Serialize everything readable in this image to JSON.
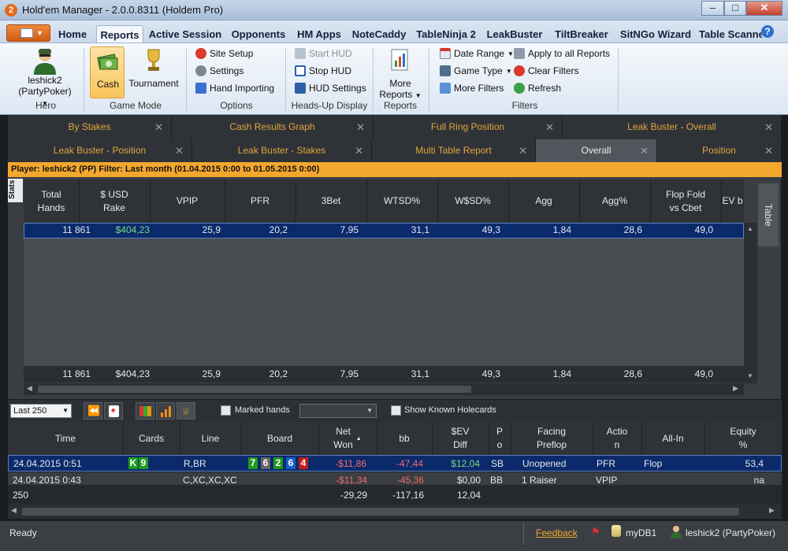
{
  "window": {
    "title": "Hold'em Manager - 2.0.0.8311 (Holdem Pro)",
    "app_badge": "2"
  },
  "ribbon_tabs": [
    "Home",
    "Reports",
    "Active Session",
    "Opponents",
    "HM Apps",
    "NoteCaddy",
    "TableNinja 2",
    "LeakBuster",
    "TiltBreaker",
    "SitNGo Wizard",
    "Table Scanner"
  ],
  "active_tab": "Reports",
  "hero": {
    "name": "leshick2",
    "site": "(PartyPoker)",
    "group": "Hero"
  },
  "game_mode": {
    "cash": "Cash",
    "tournament": "Tournament",
    "group": "Game Mode"
  },
  "options": {
    "site_setup": "Site Setup",
    "settings": "Settings",
    "hand_importing": "Hand Importing",
    "group": "Options"
  },
  "hud": {
    "start": "Start HUD",
    "stop": "Stop HUD",
    "settings": "HUD Settings",
    "group": "Heads-Up Display"
  },
  "reports": {
    "more_reports_1": "More",
    "more_reports_2": "Reports",
    "group": "Reports"
  },
  "filters": {
    "date_range": "Date Range",
    "game_type": "Game Type",
    "more_filters": "More Filters",
    "apply_all": "Apply to all Reports",
    "clear": "Clear Filters",
    "refresh": "Refresh",
    "group": "Filters"
  },
  "report_tabs_row1": [
    "By Stakes",
    "Cash Results Graph",
    "Full Ring Position",
    "Leak Buster - Overall"
  ],
  "report_tabs_row2": [
    "Leak Buster - Position",
    "Leak Buster - Stakes",
    "Multi Table Report",
    "Overall",
    "Position"
  ],
  "active_report": "Overall",
  "filter_bar": "Player: leshick2 (PP)  Filter: Last month (01.04.2015 0:00 to 01.05.2015 0:00)",
  "side_tabs": {
    "stats": "Stats",
    "table": "Table"
  },
  "stats_headers": [
    [
      "Total",
      "Hands"
    ],
    [
      "$ USD",
      "Rake"
    ],
    [
      "VPIP",
      ""
    ],
    [
      "PFR",
      ""
    ],
    [
      "3Bet",
      ""
    ],
    [
      "WTSD%",
      ""
    ],
    [
      "W$SD%",
      ""
    ],
    [
      "Agg",
      ""
    ],
    [
      "Agg%",
      ""
    ],
    [
      "Flop Fold",
      "vs Cbet"
    ],
    [
      "EV b",
      ""
    ]
  ],
  "stats_row": [
    "11 861",
    "$404,23",
    "25,9",
    "20,2",
    "7,95",
    "31,1",
    "49,3",
    "1,84",
    "28,6",
    "49,0"
  ],
  "stats_total": [
    "11 861",
    "$404,23",
    "25,9",
    "20,2",
    "7,95",
    "31,1",
    "49,3",
    "1,84",
    "28,6",
    "49,0"
  ],
  "hand_toolbar": {
    "last": "Last 250",
    "marked_hands": "Marked hands",
    "show_known": "Show Known Holecards"
  },
  "hand_headers": [
    [
      "Time",
      ""
    ],
    [
      "Cards",
      ""
    ],
    [
      "Line",
      ""
    ],
    [
      "Board",
      ""
    ],
    [
      "Net",
      "Won"
    ],
    [
      "bb",
      ""
    ],
    [
      "$EV",
      "Diff"
    ],
    [
      "P",
      "o"
    ],
    [
      "Facing",
      "Preflop"
    ],
    [
      "Actio",
      "n"
    ],
    [
      "All-In",
      ""
    ],
    [
      "Equity",
      "%"
    ]
  ],
  "hand_row1": {
    "time": "24.04.2015 0:51",
    "cards": [
      "K",
      "9"
    ],
    "line": "R,BR",
    "board": [
      "7",
      "6",
      "2",
      "6",
      "4"
    ],
    "net_won": "-$11,86",
    "bb": "-47,44",
    "ev_diff": "$12,04",
    "pos": "SB",
    "facing": "Unopened",
    "action": "PFR",
    "allin": "Flop",
    "equity": "53,4"
  },
  "hand_row2": {
    "time": "24.04.2015 0:43",
    "line": "C,XC,XC,XC",
    "net_won": "-$11,34",
    "bb": "-45,36",
    "ev_diff": "$0,00",
    "pos": "BB",
    "facing": "1 Raiser",
    "action": "VPIP",
    "equity": "na"
  },
  "hand_totals": {
    "count": "250",
    "net_won": "-29,29",
    "bb": "-117,16",
    "ev_diff": "12,04"
  },
  "status": {
    "ready": "Ready",
    "feedback": "Feedback",
    "db": "myDB1",
    "user": "leshick2 (PartyPoker)"
  },
  "colors": {
    "accent_orange": "#f4a72e",
    "positive": "#7cd87c",
    "negative": "#f06a6a",
    "selection": "#0a2a6c"
  }
}
